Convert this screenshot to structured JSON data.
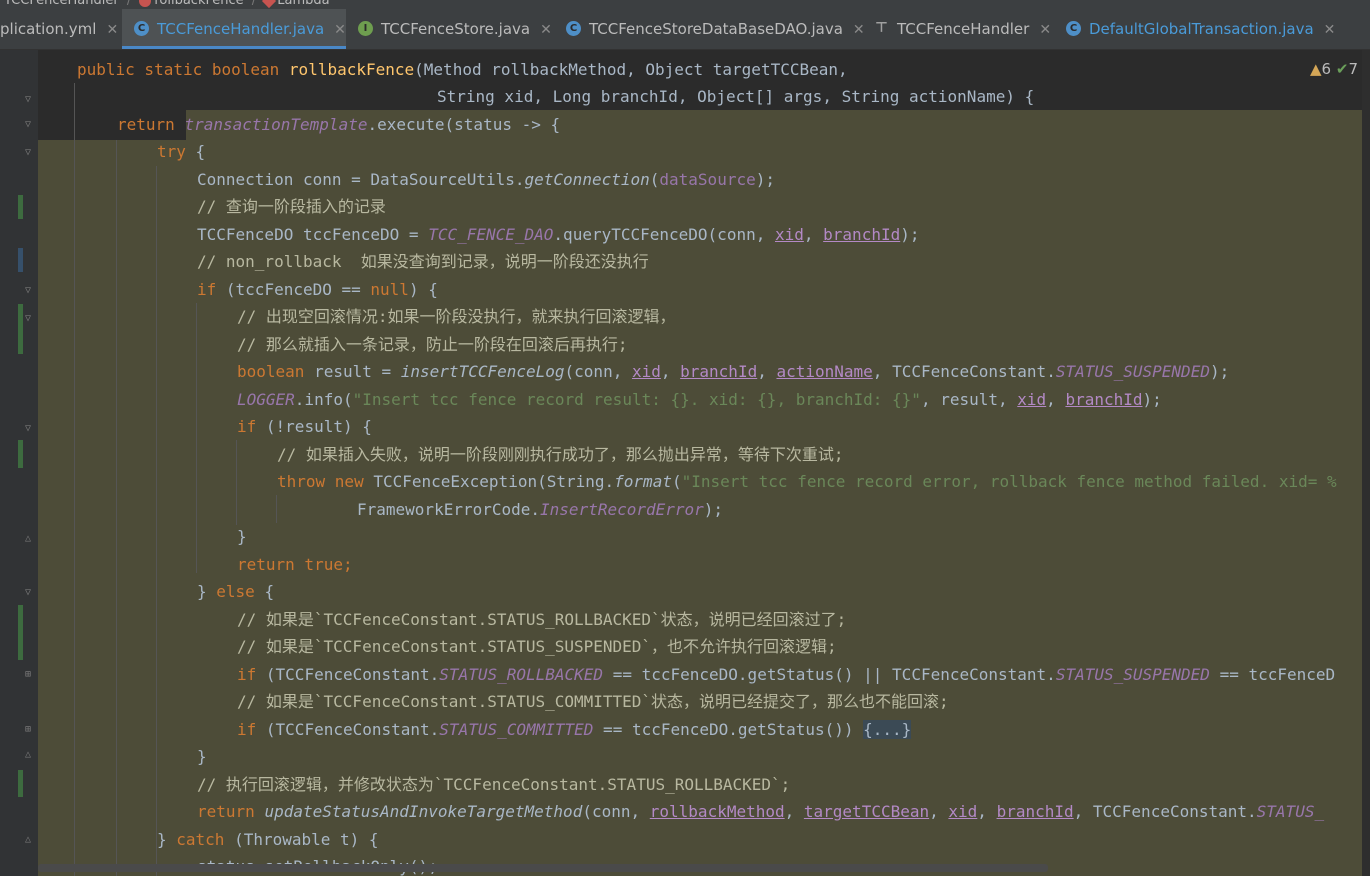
{
  "breadcrumb": [
    "TCCFenceHandler",
    "rollbackFence",
    "Lambda"
  ],
  "tabs": [
    {
      "label": "plication.yml",
      "icon": "yaml-icon",
      "active": false
    },
    {
      "label": "TCCFenceHandler.java",
      "icon": "class-icon",
      "active": true
    },
    {
      "label": "TCCFenceStore.java",
      "icon": "interface-icon",
      "active": false
    },
    {
      "label": "TCCFenceStoreDataBaseDAO.java",
      "icon": "class-icon",
      "active": false
    },
    {
      "label": "TCCFenceHandler",
      "icon": "structure-icon",
      "active": false
    },
    {
      "label": "DefaultGlobalTransaction.java",
      "icon": "class-icon",
      "active": false
    }
  ],
  "inspection": {
    "warnings": "6",
    "checks": "7",
    "warning_glyph": "▲",
    "check_glyph": "✔"
  },
  "code": {
    "l1": {
      "a": "public static boolean ",
      "b": "rollbackFence",
      "c": "(Method rollbackMethod, Object targetTCCBean,"
    },
    "l2": {
      "a": "String xid, Long branchId, Object[] args, String actionName) {"
    },
    "l3": {
      "a": "return ",
      "b": "transactionTemplate",
      "c": ".execute(status -> {"
    },
    "l4": {
      "a": "try ",
      "b": "{"
    },
    "l5": {
      "a": "Connection conn = DataSourceUtils.",
      "b": "getConnection",
      "c": "(",
      "d": "dataSource",
      "e": ");"
    },
    "l6": {
      "a": "// 查询一阶段插入的记录"
    },
    "l7": {
      "a": "TCCFenceDO tccFenceDO = ",
      "b": "TCC_FENCE_DAO",
      "c": ".queryTCCFenceDO(conn, ",
      "d": "xid",
      "e": ", ",
      "f": "branchId",
      "g": ");"
    },
    "l8": {
      "a": "// non_rollback  如果没查询到记录，说明一阶段还没执行"
    },
    "l9": {
      "a": "if ",
      "b": "(tccFenceDO == ",
      "c": "null",
      "d": ") {"
    },
    "l10": {
      "a": "// 出现空回滚情况:如果一阶段没执行，就来执行回滚逻辑，"
    },
    "l11": {
      "a": "// 那么就插入一条记录，防止一阶段在回滚后再执行;"
    },
    "l12": {
      "a": "boolean ",
      "b": "result = ",
      "c": "insertTCCFenceLog",
      "d": "(conn, ",
      "e": "xid",
      "f": ", ",
      "g": "branchId",
      "h": ", ",
      "i": "actionName",
      "j": ", TCCFenceConstant.",
      "k": "STATUS_SUSPENDED",
      "l": ");"
    },
    "l13": {
      "a": "LOGGER",
      "b": ".info(",
      "c": "\"Insert tcc fence record result: {}. xid: {}, branchId: {}\"",
      "d": ", result, ",
      "e": "xid",
      "f": ", ",
      "g": "branchId",
      "h": ");"
    },
    "l14": {
      "a": "if ",
      "b": "(!result) {"
    },
    "l15": {
      "a": "// 如果插入失败，说明一阶段刚刚执行成功了，那么抛出异常，等待下次重试;"
    },
    "l16": {
      "a": "throw new ",
      "b": "TCCFenceException(String.",
      "c": "format",
      "d": "(",
      "e": "\"Insert tcc fence record error, rollback fence method failed. xid= %"
    },
    "l17": {
      "a": "FrameworkErrorCode.",
      "b": "InsertRecordError",
      "c": ");"
    },
    "l18": {
      "a": "}"
    },
    "l19": {
      "a": "return true;"
    },
    "l20": {
      "a": "} ",
      "b": "else ",
      "c": "{"
    },
    "l21": {
      "a": "// 如果是`TCCFenceConstant.STATUS_ROLLBACKED`状态，说明已经回滚过了;"
    },
    "l22": {
      "a": "// 如果是`TCCFenceConstant.STATUS_SUSPENDED`，也不允许执行回滚逻辑;"
    },
    "l23": {
      "a": "if ",
      "b": "(TCCFenceConstant.",
      "c": "STATUS_ROLLBACKED",
      "d": " == tccFenceDO.getStatus() || TCCFenceConstant.",
      "e": "STATUS_SUSPENDED",
      "f": " == tccFenceD"
    },
    "l24": {
      "a": "// 如果是`TCCFenceConstant.STATUS_COMMITTED`状态，说明已经提交了，那么也不能回滚;"
    },
    "l25": {
      "a": "if ",
      "b": "(TCCFenceConstant.",
      "c": "STATUS_COMMITTED",
      "d": " == tccFenceDO.getStatus()) ",
      "e": "{...}"
    },
    "l26": {
      "a": "}"
    },
    "l27": {
      "a": "// 执行回滚逻辑，并修改状态为`TCCFenceConstant.STATUS_ROLLBACKED`;"
    },
    "l28": {
      "a": "return ",
      "b": "updateStatusAndInvokeTargetMethod",
      "c": "(conn, ",
      "d": "rollbackMethod",
      "e": ", ",
      "f": "targetTCCBean",
      "g": ", ",
      "h": "xid",
      "i": ", ",
      "j": "branchId",
      "k": ", TCCFenceConstant.",
      "l": "STATUS_"
    },
    "l29": {
      "a": "} ",
      "b": "catch ",
      "c": "(Throwable t) {"
    },
    "l30": {
      "a": "status.setRollbackOnly();"
    }
  }
}
